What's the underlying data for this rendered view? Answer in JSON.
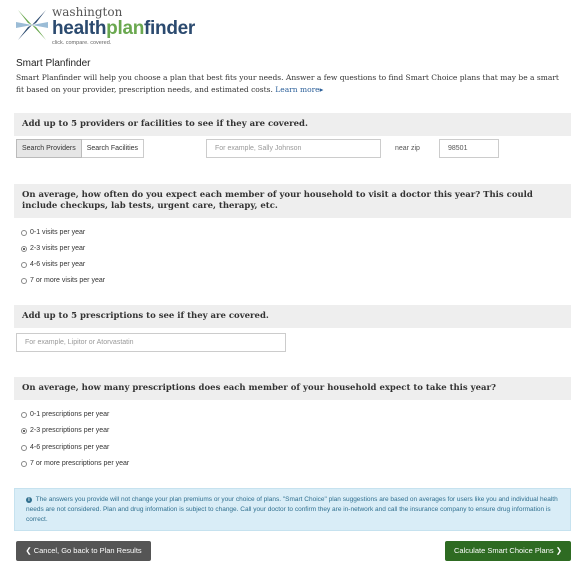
{
  "logo": {
    "small": "washington",
    "big_part1": "health",
    "big_part2": "plan",
    "big_part3": "finder",
    "tagline": "click. compare. covered."
  },
  "page_title": "Smart Planfinder",
  "intro": {
    "text": "Smart Planfinder will help you choose a plan that best fits your needs. Answer a few questions to find Smart Choice plans that may be a smart fit based on your provider, prescription needs, and estimated costs.",
    "link": "Learn more",
    "link_arrow": "▸"
  },
  "providers": {
    "heading": "Add up to 5 providers or facilities to see if they are covered.",
    "tab_providers": "Search Providers",
    "tab_facilities": "Search Facilities",
    "search_placeholder": "For example, Sally Johnson",
    "near_label": "near zip",
    "zip_value": "98501"
  },
  "visits": {
    "heading": "On average, how often do you expect each member of your household to visit a doctor this year? This could include checkups, lab tests, urgent care, therapy, etc.",
    "options": [
      "0-1 visits per year",
      "2-3 visits per year",
      "4-6 visits per year",
      "7 or more visits per year"
    ],
    "selected_index": 1
  },
  "prescriptions_search": {
    "heading": "Add up to 5 prescriptions to see if they are covered.",
    "placeholder": "For example, Lipitor or Atorvastatin"
  },
  "prescriptions_count": {
    "heading": "On average, how many prescriptions does each member of your household expect to take this year?",
    "options": [
      "0-1 prescriptions per year",
      "2-3 prescriptions per year",
      "4-6 prescriptions per year",
      "7 or more prescriptions per year"
    ],
    "selected_index": 1
  },
  "notice": "The answers you provide will not change your plan premiums or your choice of plans. \"Smart Choice\" plan suggestions are based on averages for users like you and individual health needs are not considered. Plan and drug information is subject to change. Call your doctor to confirm they are in-network and call the insurance company to ensure drug information is correct.",
  "buttons": {
    "cancel_icon": "❮",
    "cancel": "Cancel, Go back to Plan Results",
    "calculate": "Calculate Smart Choice Plans",
    "calculate_icon": "❯"
  },
  "colors": {
    "brand_blue": "#2b4a6f",
    "brand_green": "#6aa84f",
    "calc_button": "#2e6b22",
    "cancel_button": "#555555",
    "notice_bg": "#d9edf7"
  }
}
